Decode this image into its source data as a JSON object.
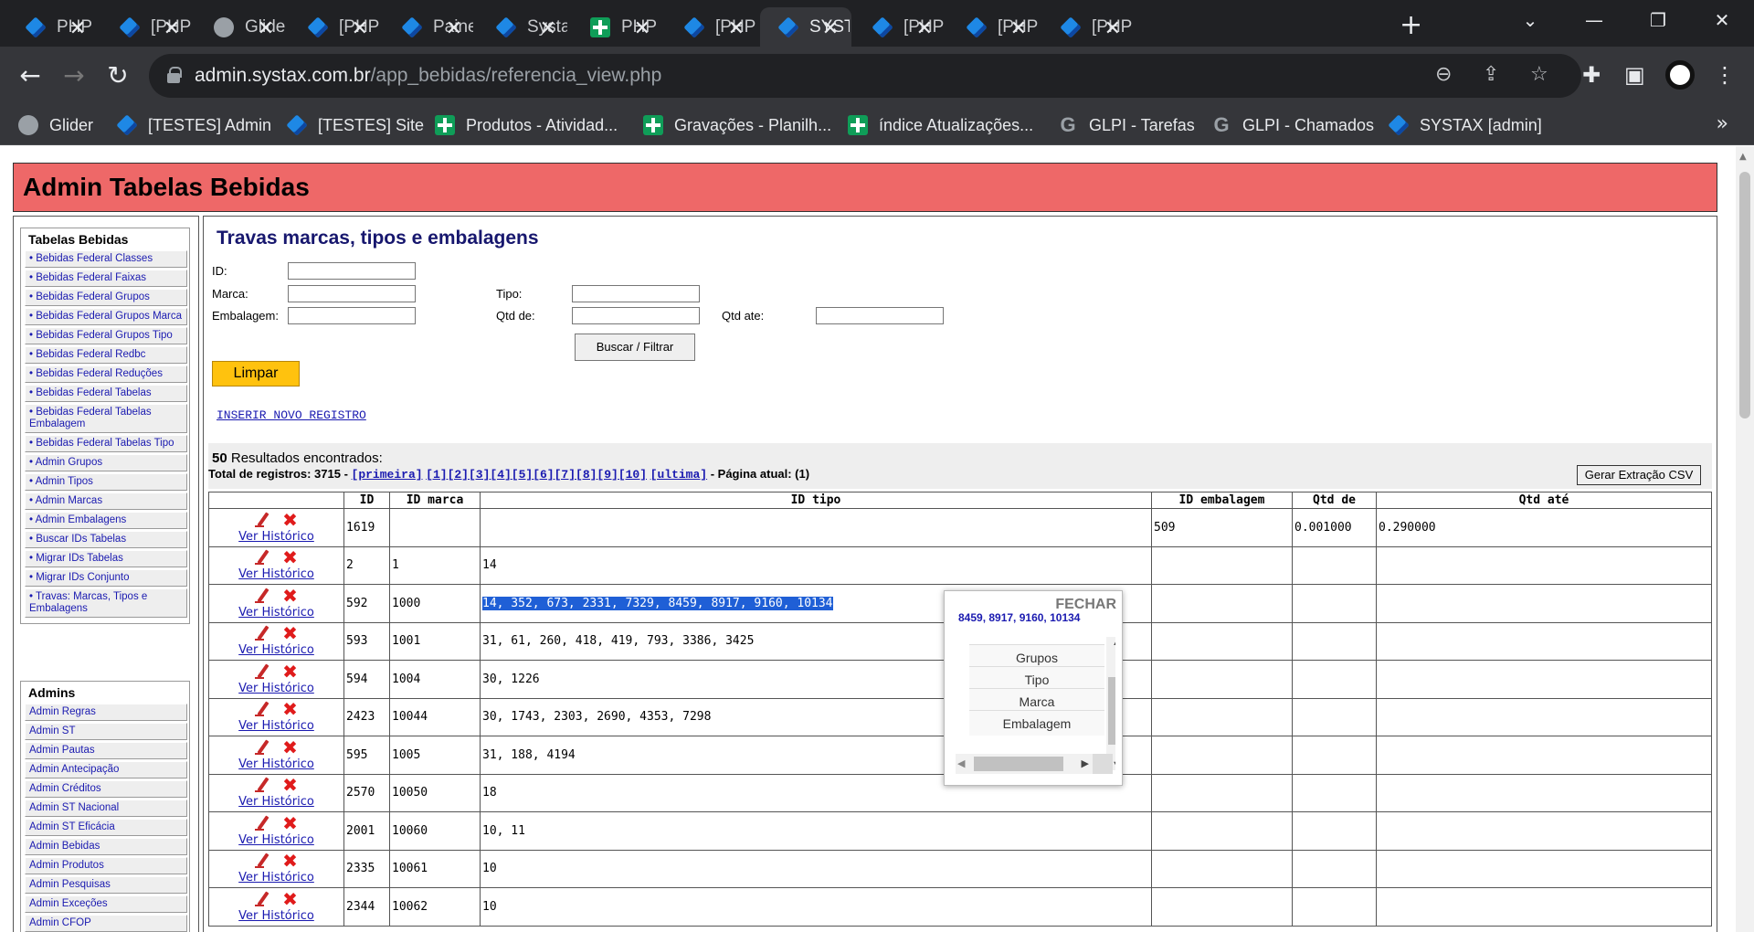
{
  "browser": {
    "tabs": [
      {
        "title": "PHP",
        "icon": "diamond",
        "active": false
      },
      {
        "title": "[PHP",
        "icon": "diamond",
        "active": false
      },
      {
        "title": "Glider",
        "icon": "globe",
        "active": false
      },
      {
        "title": "[PHP",
        "icon": "diamond",
        "active": false
      },
      {
        "title": "Painel",
        "icon": "diamond",
        "active": false
      },
      {
        "title": "Systax",
        "icon": "diamond",
        "active": false
      },
      {
        "title": "PHP",
        "icon": "sheet",
        "active": false
      },
      {
        "title": "[PHP",
        "icon": "diamond",
        "active": false
      },
      {
        "title": "SYSTAX",
        "icon": "diamond",
        "active": true
      },
      {
        "title": "[PHP",
        "icon": "diamond",
        "active": false
      },
      {
        "title": "[PHP",
        "icon": "diamond",
        "active": false
      },
      {
        "title": "[PHP",
        "icon": "diamond",
        "active": false
      }
    ],
    "url_host": "admin.systax.com.br",
    "url_path": "/app_bebidas/referencia_view.php",
    "bookmarks": [
      {
        "label": "Glider",
        "icon": "globe"
      },
      {
        "label": "[TESTES] Admin",
        "icon": "diamond"
      },
      {
        "label": "[TESTES] Site",
        "icon": "diamond"
      },
      {
        "label": "Produtos - Atividad...",
        "icon": "sheet"
      },
      {
        "label": "Gravações - Planilh...",
        "icon": "sheet"
      },
      {
        "label": "índice Atualizações...",
        "icon": "sheet"
      },
      {
        "label": "GLPI - Tarefas",
        "icon": "g"
      },
      {
        "label": "GLPI - Chamados",
        "icon": "g"
      },
      {
        "label": "SYSTAX [admin]",
        "icon": "diamond"
      }
    ],
    "bookmarks_more": "»"
  },
  "header": {
    "title": "Admin Tabelas Bebidas"
  },
  "sidebar": {
    "box1_title": "Tabelas Bebidas",
    "box1_items": [
      "• Bebidas Federal Classes",
      "• Bebidas Federal Faixas",
      "• Bebidas Federal Grupos",
      "• Bebidas Federal Grupos Marca",
      "• Bebidas Federal Grupos Tipo",
      "• Bebidas Federal Redbc",
      "• Bebidas Federal Reduções",
      "• Bebidas Federal Tabelas",
      "• Bebidas Federal Tabelas Embalagem",
      "• Bebidas Federal Tabelas Tipo",
      "• Admin Grupos",
      "• Admin Tipos",
      "• Admin Marcas",
      "• Admin Embalagens",
      "• Buscar IDs Tabelas",
      "• Migrar IDs Tabelas",
      "• Migrar IDs Conjunto",
      "• Travas: Marcas, Tipos e Embalagens"
    ],
    "box2_title": "Admins",
    "box2_items": [
      "Admin Regras",
      "Admin ST",
      "Admin Pautas",
      "Admin Antecipação",
      "Admin Créditos",
      "Admin ST Nacional",
      "Admin ST Eficácia",
      "Admin Bebidas",
      "Admin Produtos",
      "Admin Pesquisas",
      "Admin Exceções",
      "Admin CFOP"
    ]
  },
  "form": {
    "title": "Travas marcas, tipos e embalagens",
    "labels": {
      "id": "ID:",
      "marca": "Marca:",
      "embalagem": "Embalagem:",
      "tipo": "Tipo:",
      "qtd_de": "Qtd de:",
      "qtd_ate": "Qtd ate:"
    },
    "buscar_label": "Buscar / Filtrar",
    "limpar_label": "Limpar",
    "inserir_label": "INSERIR NOVO REGISTRO"
  },
  "results": {
    "count": "50",
    "count_suffix": "Resultados encontrados:",
    "total_label": "Total de registros: 3715 - ",
    "first": "[primeira]",
    "pages": [
      "[1]",
      "[2]",
      "[3]",
      "[4]",
      "[5]",
      "[6]",
      "[7]",
      "[8]",
      "[9]",
      "[10]"
    ],
    "last": "[ultima]",
    "current": " - Página atual: (1)",
    "csv_label": "Gerar Extração CSV"
  },
  "table": {
    "headers": [
      "",
      "ID",
      "ID marca",
      "ID tipo",
      "ID embalagem",
      "Qtd de",
      "Qtd até"
    ],
    "history_label": "Ver Histórico",
    "rows": [
      {
        "id": "1619",
        "marca": "",
        "tipo": "",
        "embalagem": "509",
        "qtd_de": "0.001000",
        "qtd_ate": "0.290000",
        "selected": false
      },
      {
        "id": "2",
        "marca": "1",
        "tipo": "14",
        "embalagem": "",
        "qtd_de": "",
        "qtd_ate": "",
        "selected": false
      },
      {
        "id": "592",
        "marca": "1000",
        "tipo": "14, 352, 673, 2331, 7329, 8459, 8917, 9160, 10134",
        "embalagem": "",
        "qtd_de": "",
        "qtd_ate": "",
        "selected": true
      },
      {
        "id": "593",
        "marca": "1001",
        "tipo": "31, 61, 260, 418, 419, 793, 3386, 3425",
        "embalagem": "",
        "qtd_de": "",
        "qtd_ate": "",
        "selected": false
      },
      {
        "id": "594",
        "marca": "1004",
        "tipo": "30, 1226",
        "embalagem": "",
        "qtd_de": "",
        "qtd_ate": "",
        "selected": false
      },
      {
        "id": "2423",
        "marca": "10044",
        "tipo": "30, 1743, 2303, 2690, 4353, 7298",
        "embalagem": "",
        "qtd_de": "",
        "qtd_ate": "",
        "selected": false
      },
      {
        "id": "595",
        "marca": "1005",
        "tipo": "31, 188, 4194",
        "embalagem": "",
        "qtd_de": "",
        "qtd_ate": "",
        "selected": false
      },
      {
        "id": "2570",
        "marca": "10050",
        "tipo": "18",
        "embalagem": "",
        "qtd_de": "",
        "qtd_ate": "",
        "selected": false
      },
      {
        "id": "2001",
        "marca": "10060",
        "tipo": "10, 11",
        "embalagem": "",
        "qtd_de": "",
        "qtd_ate": "",
        "selected": false
      },
      {
        "id": "2335",
        "marca": "10061",
        "tipo": "10",
        "embalagem": "",
        "qtd_de": "",
        "qtd_ate": "",
        "selected": false
      },
      {
        "id": "2344",
        "marca": "10062",
        "tipo": "10",
        "embalagem": "",
        "qtd_de": "",
        "qtd_ate": "",
        "selected": false
      }
    ]
  },
  "popup": {
    "close_label": "FECHAR",
    "selected_text": "8459, 8917, 9160, 10134",
    "options": [
      "Grupos",
      "Tipo",
      "Marca",
      "Embalagem"
    ]
  },
  "colors": {
    "header_bg": "#ee6868",
    "limpar_bg": "#ffc20e",
    "link": "#1a1ab0",
    "selection": "#1f5fd6",
    "title": "#17176e"
  }
}
